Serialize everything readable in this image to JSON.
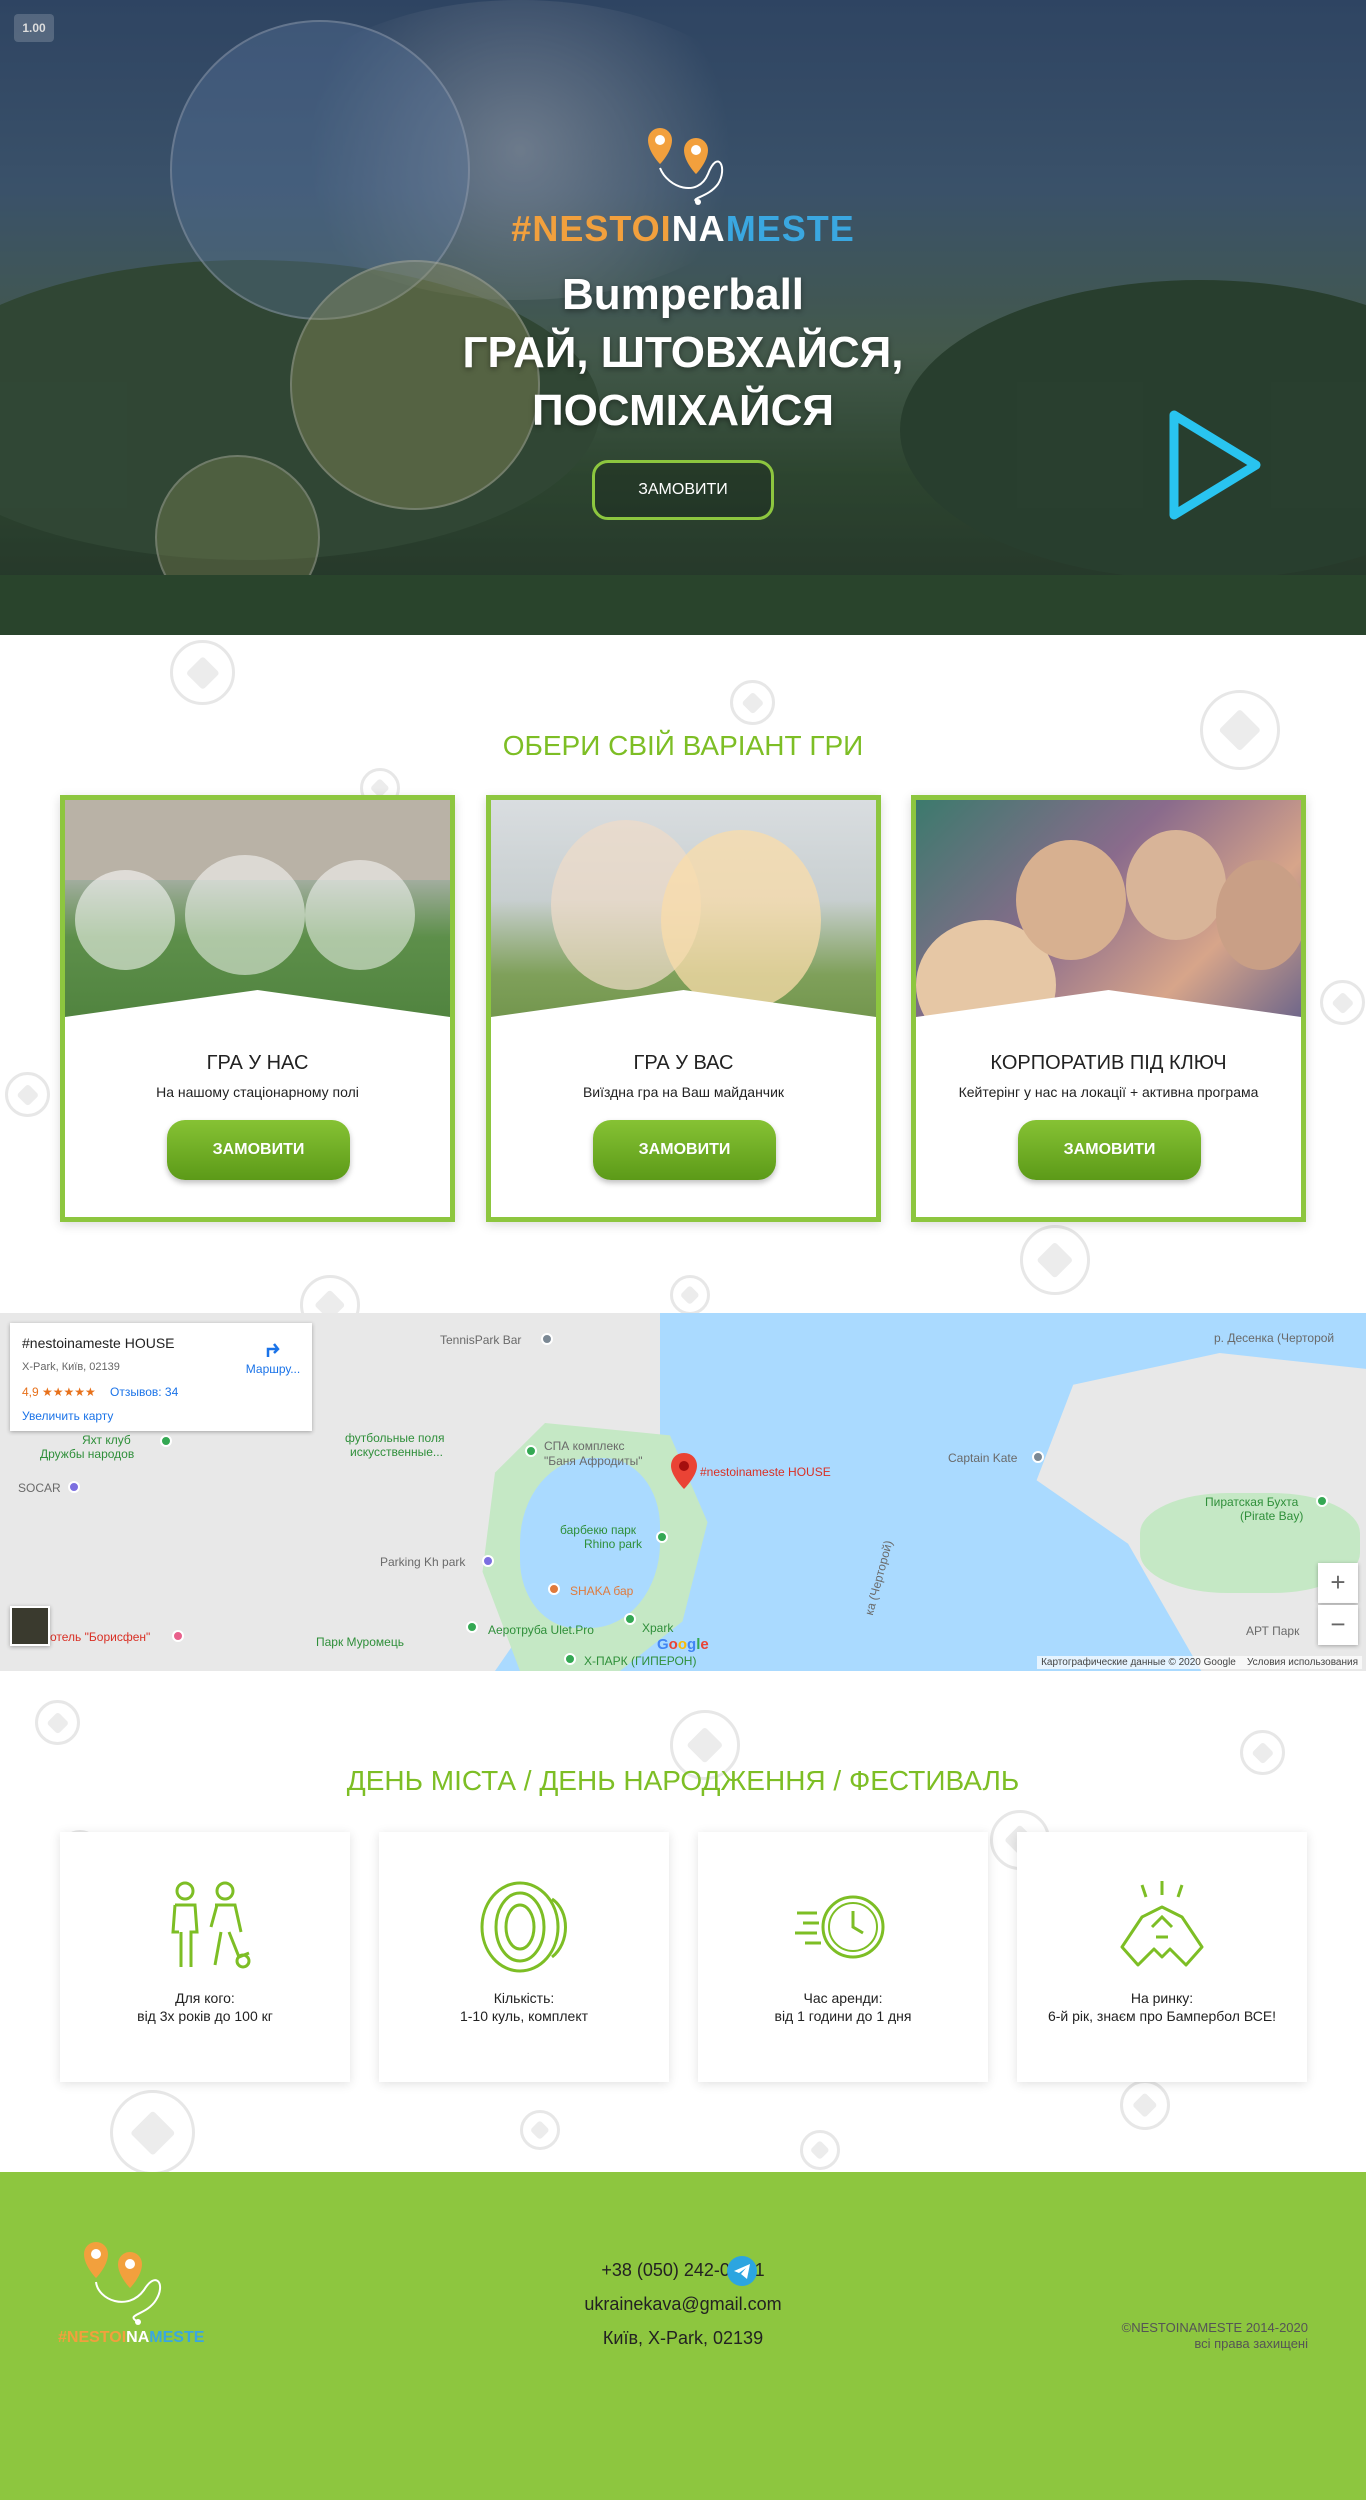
{
  "hero": {
    "zoom": "1.00",
    "brand": {
      "part1": "#NESTOI",
      "part2": "NA",
      "part3": "MESTE"
    },
    "title_line1": "Bumperball",
    "title_line2": "ГРАЙ, ШТОВХАЙСЯ,",
    "title_line3": "ПОСМІХАЙСЯ",
    "order_button": "ЗАМОВИТИ"
  },
  "options": {
    "title": "ОБЕРИ СВІЙ ВАРІАНТ ГРИ",
    "cards": [
      {
        "title": "ГРА У НАС",
        "subtitle": "На нашому стаціонарному полі",
        "button": "ЗАМОВИТИ"
      },
      {
        "title": "ГРА У ВАС",
        "subtitle": "Виїздна гра на Ваш майданчик",
        "button": "ЗАМОВИТИ"
      },
      {
        "title": "КОРПОРАТИВ ПІД КЛЮЧ",
        "subtitle": "Кейтерінг у нас на локації + активна програма",
        "button": "ЗАМОВИТИ"
      }
    ]
  },
  "map": {
    "info": {
      "name": "#nestoinameste HOUSE",
      "address": "X-Park, Київ, 02139",
      "rating": "4,9 ★★★★★",
      "reviews": "Отзывов: 34",
      "enlarge": "Увеличить карту",
      "route": "Маршру..."
    },
    "labels": {
      "tennis": "TennisPark Bar",
      "desenka": "р. Десенка (Черторой",
      "yacht1": "Яхт клуб",
      "yacht2": "Дружбы народов",
      "socar": "SOCAR",
      "football1": "футбольные поля",
      "football2": "искусственные...",
      "spa1": "СПА комплекс",
      "spa2": "\"Баня Афродиты\"",
      "house": "#nestoinameste HOUSE",
      "captain": "Captain Kate",
      "pirate1": "Пиратская Бухта",
      "pirate2": "(Pirate Bay)",
      "barbecue1": "барбекю парк",
      "barbecue2": "Rhino park",
      "parking": "Parking Kh park",
      "shaka": "SHAKA бар",
      "hotel": "отель \"Борисфен\"",
      "muromets": "Парк Муромець",
      "aerotruba": "Аеротруба Ulet.Pro",
      "xpark": "Xpark",
      "xpark2": "Х-ПАРК (ГИПЕРОН)",
      "chortoroi": "ка (Черторой)",
      "art": "АРТ Парк"
    },
    "zoom_in": "+",
    "zoom_out": "−",
    "footer_data": "Картографические данные © 2020 Google",
    "footer_terms": "Условия использования",
    "google": "Google"
  },
  "features": {
    "title": "ДЕНЬ МІСТА / ДЕНЬ НАРОДЖЕННЯ / ФЕСТИВАЛЬ",
    "items": [
      {
        "label": "Для кого:",
        "value": "від 3х років до 100 кг",
        "icon": "players-icon"
      },
      {
        "label": "Кількість:",
        "value": "1-10 куль, комплект",
        "icon": "bubble-ball-icon"
      },
      {
        "label": "Час аренди:",
        "value": "від 1 години до 1 дня",
        "icon": "clock-icon"
      },
      {
        "label": "На ринку:",
        "value": "6-й рік, знаєм про Бампербол ВСЕ!",
        "icon": "handshake-icon"
      }
    ]
  },
  "footer": {
    "phone": "+38 (050) 242-02-11",
    "email": "ukrainekava@gmail.com",
    "address": "Київ, X-Park, 02139",
    "copyright": "©NESTOINAMESTE 2014-2020",
    "rights": "всі права захищені",
    "brand": {
      "part1": "#NESTOI",
      "part2": "NA",
      "part3": "MESTE"
    }
  },
  "colors": {
    "accent_green": "#8dc63f",
    "title_green": "#7dbe25",
    "brand_orange": "#f2a03d",
    "brand_blue": "#3aa7e0"
  }
}
